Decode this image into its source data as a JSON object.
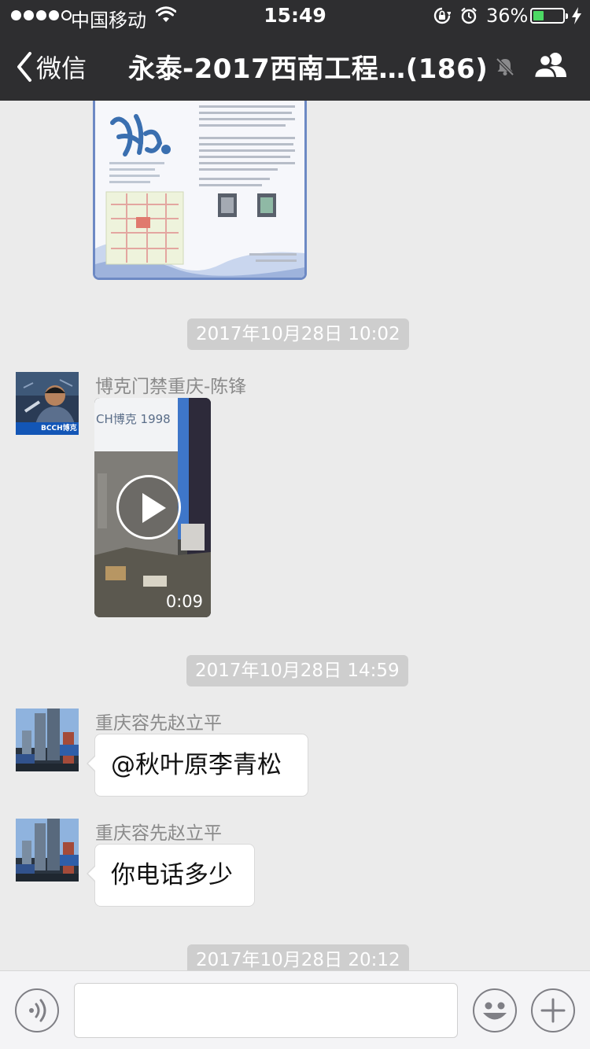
{
  "status_bar": {
    "carrier": "中国移动",
    "time": "15:49",
    "battery_percent": "36%",
    "battery_level": 0.36
  },
  "nav": {
    "back_label": "微信",
    "title": "永泰-2017西南工程…(186)"
  },
  "timestamps": [
    "2017年10月28日 10:02",
    "2017年10月28日 14:59",
    "2017年10月28日 20:12"
  ],
  "messages": [
    {
      "sender": "博克门禁重庆-陈锋",
      "type": "video",
      "duration": "0:09",
      "avatar_text": "BCCH博克",
      "video_text": "CH博克 1998"
    },
    {
      "sender": "重庆容先赵立平",
      "type": "text",
      "text": "@秋叶原李青松"
    },
    {
      "sender": "重庆容先赵立平",
      "type": "text",
      "text": "你电话多少"
    }
  ],
  "icons": [
    "back-chevron-icon",
    "mute-icon",
    "group-members-icon",
    "voice-icon",
    "emoji-icon",
    "add-icon"
  ]
}
